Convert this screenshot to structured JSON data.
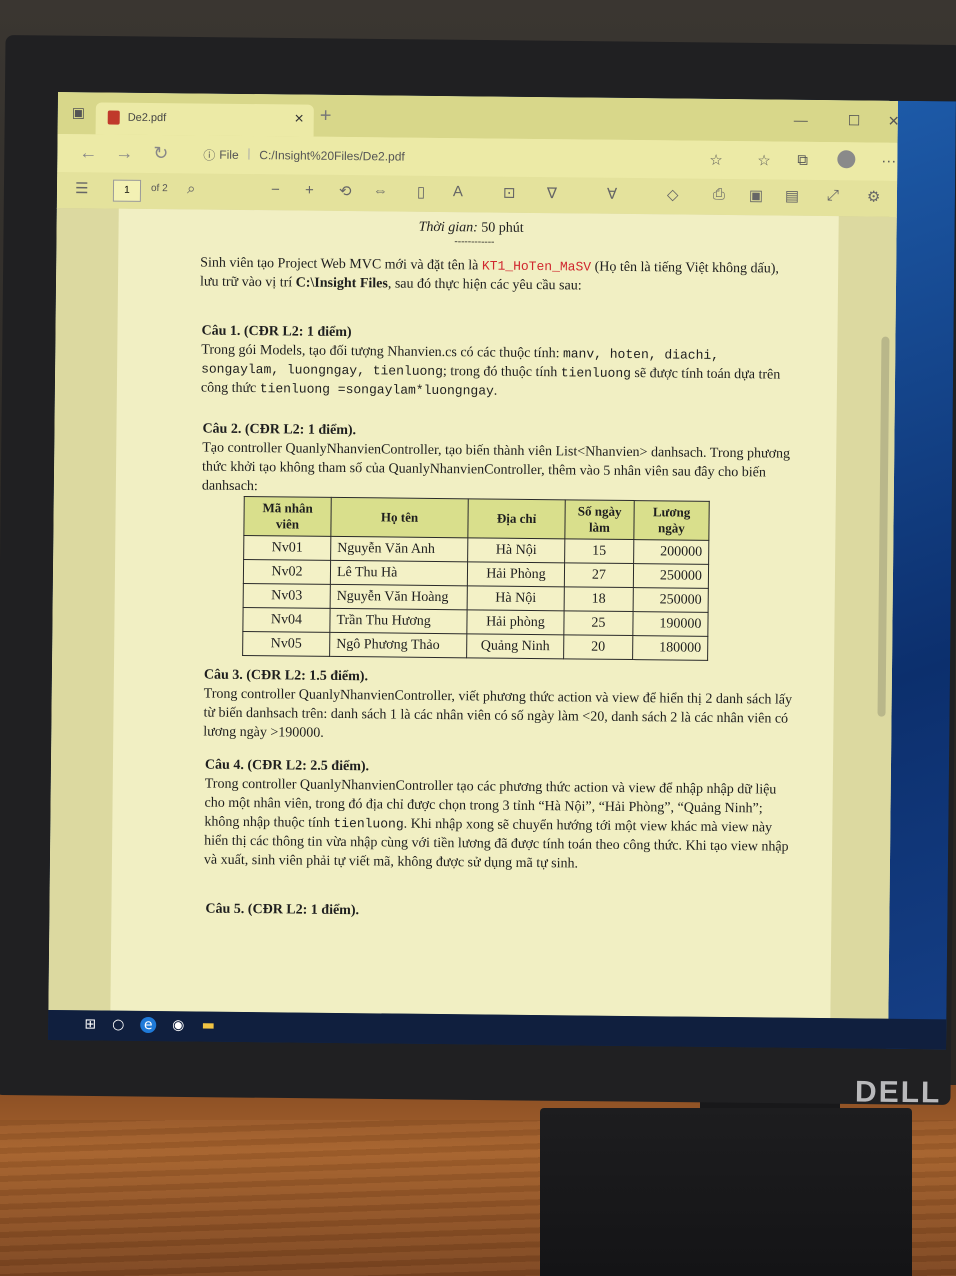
{
  "browser": {
    "tab_title": "De2.pdf",
    "address_file_label": "File",
    "address_path": "C:/Insight%20Files/De2.pdf"
  },
  "pdf_toolbar": {
    "page_number": "1",
    "page_total": "of 2"
  },
  "document": {
    "duration_label": "Thời gian:",
    "duration_value": "50 phút",
    "dashes": "------------",
    "intro_1": "Sinh viên tạo Project Web MVC mới và đặt tên là ",
    "intro_project_name": "KT1_HoTen_MaSV",
    "intro_2": " (Họ tên là tiếng Việt không dấu), lưu trữ vào vị trí ",
    "intro_location": "C:\\Insight Files",
    "intro_3": ", sau đó thực hiện các yêu cầu sau:",
    "q1_heading": "Câu 1. (CĐR L2: 1 điểm)",
    "q1_text_a": "Trong gói Models, tạo đối tượng Nhanvien.cs có các thuộc tính: ",
    "q1_props": "manv, hoten, diachi, songaylam, luongngay, tienluong",
    "q1_text_b": "; trong đó thuộc tính ",
    "q1_prop_tienluong": "tienluong",
    "q1_text_c": " sẽ được tính toán dựa trên công thức ",
    "q1_formula": "tienluong =songaylam*luongngay",
    "q1_text_d": ".",
    "q2_heading": "Câu 2. (CĐR L2: 1 điểm).",
    "q2_text": "Tạo controller QuanlyNhanvienController, tạo biến thành viên List<Nhanvien> danhsach. Trong phương thức khởi tạo không tham số của QuanlyNhanvienController, thêm vào 5 nhân viên sau đây cho biến danhsach:",
    "table": {
      "headers": [
        "Mã nhân viên",
        "Họ tên",
        "Địa chỉ",
        "Số ngày làm",
        "Lương ngày"
      ],
      "rows": [
        [
          "Nv01",
          "Nguyễn Văn Anh",
          "Hà Nội",
          "15",
          "200000"
        ],
        [
          "Nv02",
          "Lê Thu Hà",
          "Hải Phòng",
          "27",
          "250000"
        ],
        [
          "Nv03",
          "Nguyễn Văn Hoàng",
          "Hà Nội",
          "18",
          "250000"
        ],
        [
          "Nv04",
          "Trần Thu Hương",
          "Hải phòng",
          "25",
          "190000"
        ],
        [
          "Nv05",
          "Ngô Phương Thảo",
          "Quảng Ninh",
          "20",
          "180000"
        ]
      ]
    },
    "q3_heading": "Câu 3. (CĐR L2: 1.5 điểm).",
    "q3_text": "Trong controller QuanlyNhanvienController, viết phương thức action và view để hiển thị 2 danh sách lấy từ biến danhsach trên: danh sách 1 là các nhân viên có số ngày làm <20, danh sách 2 là các nhân viên có lương ngày >190000.",
    "q4_heading": "Câu 4. (CĐR L2: 2.5 điểm).",
    "q4_text_a": "Trong controller QuanlyNhanvienController tạo các phương thức action và view để nhập nhập dữ liệu cho một nhân viên, trong đó địa chỉ được chọn trong 3 tỉnh “Hà Nội”, “Hải Phòng”, “Quảng Ninh”; không nhập thuộc tính ",
    "q4_prop": "tienluong",
    "q4_text_b": ". Khi nhập xong sẽ chuyển hướng tới một view khác mà view này hiển thị các thông tin vừa nhập cùng với tiền lương đã được tính toán theo công thức. Khi tạo view nhập và xuất, sinh viên phải tự viết mã, không được sử dụng mã tự sinh.",
    "q5_heading": "Câu 5. (CĐR L2: 1 điểm)."
  },
  "monitor": {
    "brand": "DELL"
  },
  "icons": [
    "back-icon",
    "forward-icon",
    "refresh-icon",
    "info-icon",
    "favorite-icon",
    "collections-icon",
    "profile-icon",
    "more-icon",
    "contents-icon",
    "search-icon",
    "zoom-out-icon",
    "zoom-in-icon",
    "rotate-icon",
    "fit-icon",
    "page-view-icon",
    "read-aloud-icon",
    "text-icon",
    "draw-icon",
    "highlight-icon",
    "erase-icon",
    "print-icon",
    "save-icon",
    "save-as-icon",
    "fullscreen-icon",
    "settings-icon",
    "windows-icon",
    "cortana-icon",
    "edge-icon",
    "chrome-icon",
    "file-explorer-icon"
  ]
}
